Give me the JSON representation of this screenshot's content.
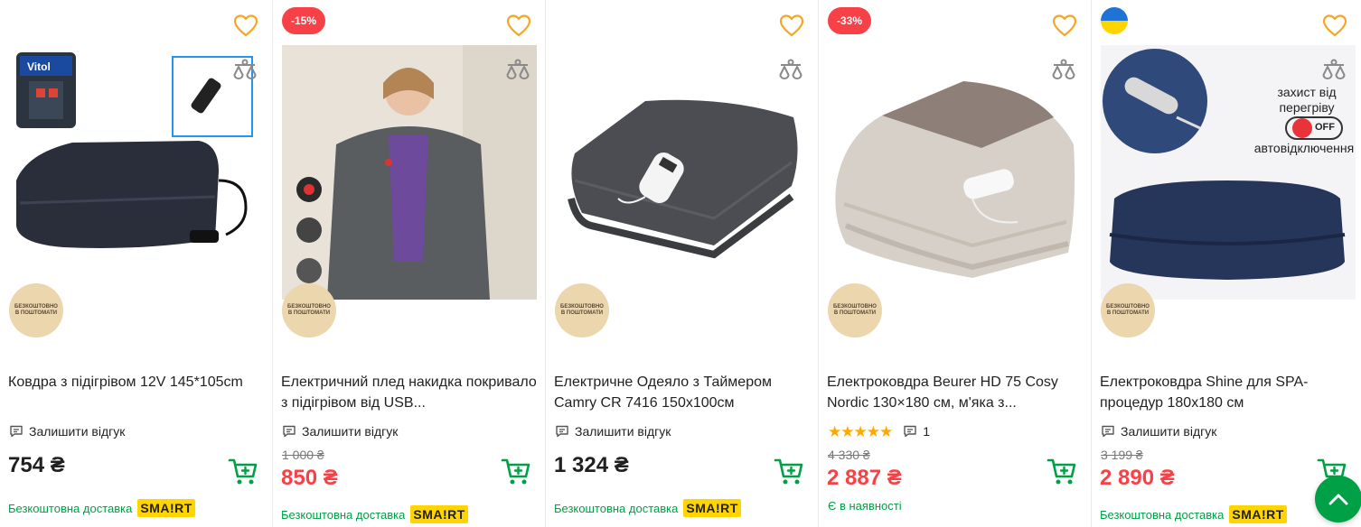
{
  "badge_text": "БЕЗКОШТОВНО В ПОШТОМАТИ",
  "colors": {
    "accent_green": "#00a046",
    "discount_red": "#f84147",
    "heart_orange": "#f5a623",
    "smart_yellow": "#ffd500"
  },
  "products": [
    {
      "title": "Ковдра з підігрівом 12V 145*105cm",
      "review_label": "Залишити відгук",
      "price": "754 ₴",
      "delivery_label": "Безкоштовна доставка",
      "smart_label": "SMA!RT"
    },
    {
      "discount": "-15%",
      "title": "Електричний плед накидка покривало з підігрівом від USB...",
      "review_label": "Залишити відгук",
      "old_price": "1 000 ₴",
      "price": "850 ₴",
      "delivery_label": "Безкоштовна доставка",
      "smart_label": "SMA!RT"
    },
    {
      "title": "Електричне Одеяло з Таймером Camry CR 7416 150х100см",
      "review_label": "Залишити відгук",
      "price": "1 324 ₴",
      "delivery_label": "Безкоштовна доставка",
      "smart_label": "SMA!RT"
    },
    {
      "discount": "-33%",
      "title": "Електроковдра Beurer HD 75 Cosy Nordic 130×180 см, м'яка з...",
      "rating": 5,
      "review_count": "1",
      "old_price": "4 330 ₴",
      "price": "2 887 ₴",
      "stock_label": "Є в наявності"
    },
    {
      "title": "Електроковдра Shine для SPA-процедур 180х180 см",
      "review_label": "Залишити відгук",
      "old_price": "3 199 ₴",
      "price": "2 890 ₴",
      "delivery_label": "Безкоштовна доставка",
      "smart_label": "SMA!RT",
      "image_text": {
        "line1": "захист від",
        "line2": "перегріву",
        "off": "OFF",
        "line3": "автовідключення"
      }
    }
  ]
}
